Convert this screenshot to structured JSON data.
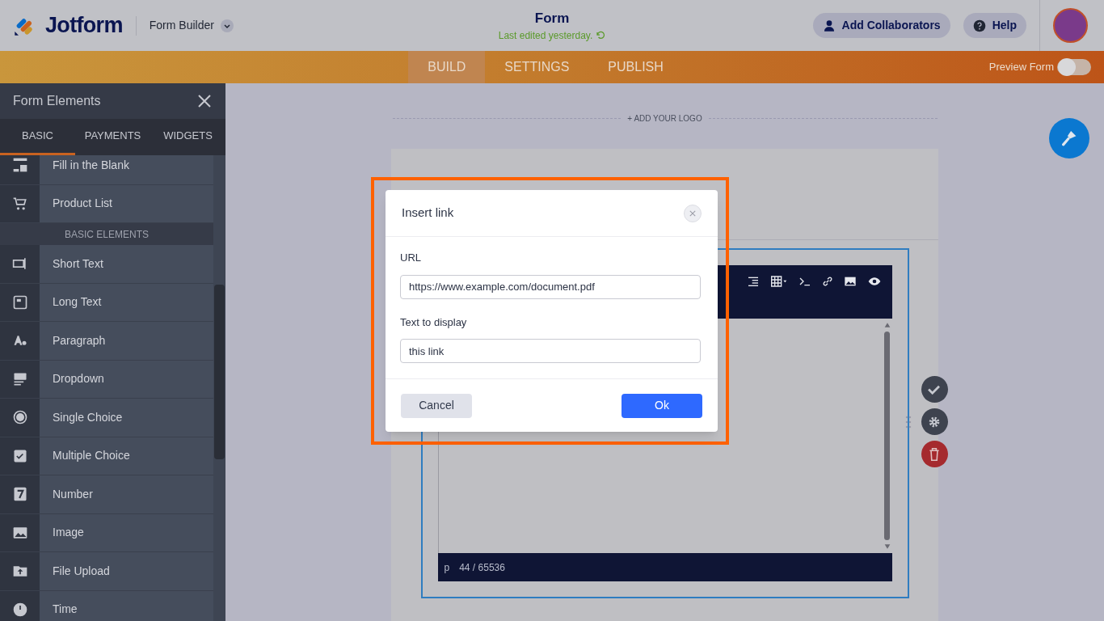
{
  "header": {
    "brand": "Jotform",
    "mode_menu": "Form Builder",
    "title": "Form",
    "last_edited": "Last edited yesterday.",
    "buttons": [
      "Add Collaborators",
      "Help"
    ]
  },
  "nav": {
    "tabs": [
      {
        "label": "BUILD",
        "selected": true
      },
      {
        "label": "SETTINGS",
        "selected": false
      },
      {
        "label": "PUBLISH",
        "selected": false
      }
    ],
    "preview": {
      "label": "Preview Form",
      "on": false
    }
  },
  "sidebar": {
    "title": "Form Elements",
    "tabs": [
      {
        "label": "BASIC",
        "selected": true
      },
      {
        "label": "PAYMENTS",
        "selected": false
      },
      {
        "label": "WIDGETS",
        "selected": false
      }
    ],
    "items": [
      {
        "kind": "item",
        "label": "Fill in the Blank"
      },
      {
        "kind": "item",
        "label": "Product List"
      },
      {
        "kind": "section",
        "label": "BASIC ELEMENTS"
      },
      {
        "kind": "item",
        "label": "Short Text"
      },
      {
        "kind": "item",
        "label": "Long Text"
      },
      {
        "kind": "item",
        "label": "Paragraph"
      },
      {
        "kind": "item",
        "label": "Dropdown"
      },
      {
        "kind": "item",
        "label": "Single Choice"
      },
      {
        "kind": "item",
        "label": "Multiple Choice"
      },
      {
        "kind": "item",
        "label": "Number"
      },
      {
        "kind": "item",
        "label": "Image"
      },
      {
        "kind": "item",
        "label": "File Upload"
      },
      {
        "kind": "item",
        "label": "Time"
      }
    ]
  },
  "canvas": {
    "logo_link": "+ ADD YOUR LOGO",
    "editor": {
      "status_tag": "p",
      "count": "44 / 65536"
    }
  },
  "dialog": {
    "title": "Insert link",
    "fields": [
      {
        "label": "URL",
        "value": "https://www.example.com/document.pdf"
      },
      {
        "label": "Text to display",
        "value": "this link"
      }
    ],
    "cancel": "Cancel",
    "ok": "Ok"
  }
}
